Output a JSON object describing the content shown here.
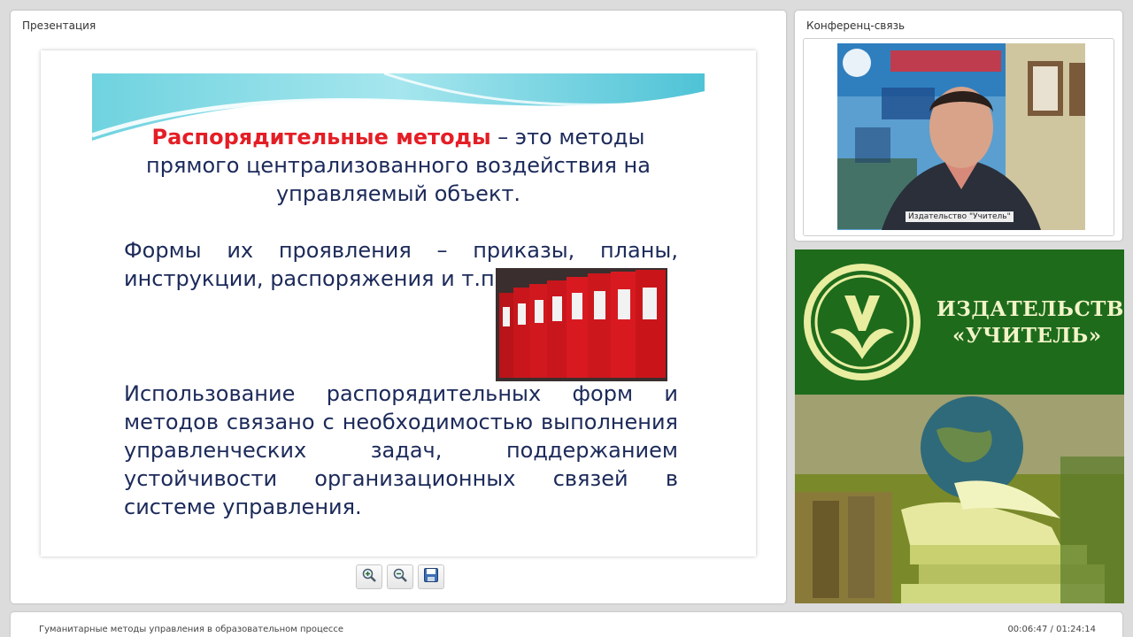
{
  "presentation": {
    "panel_title": "Презентация",
    "slide": {
      "heading_bold": "Распорядительные методы",
      "heading_rest": " – это методы прямого централизованного воздействия на управляемый объект.",
      "forms": "Формы их проявления – приказы, планы, инструкции, распоряжения и т.п.",
      "usage": "Использование распорядительных форм и методов связано с необходимостью выполнения управленческих задач, поддержанием устойчивости организационных связей в системе управления."
    },
    "toolbar": {
      "zoom_in": "zoom-in-icon",
      "zoom_out": "zoom-out-icon",
      "save": "save-icon"
    }
  },
  "conference": {
    "panel_title": "Конференц-связь",
    "video_label": "Издательство \"Учитель\""
  },
  "banner": {
    "line1": "ИЗДАТЕЛЬСТВО",
    "line2": "«УЧИТЕЛЬ»"
  },
  "footer": {
    "title": "Гуманитарные методы управления в образовательном процессе",
    "time": "00:06:47 / 01:24:14"
  },
  "colors": {
    "accent_red": "#e41e26",
    "slide_text": "#1c2a5a",
    "banner_green": "#1e6b1c"
  }
}
